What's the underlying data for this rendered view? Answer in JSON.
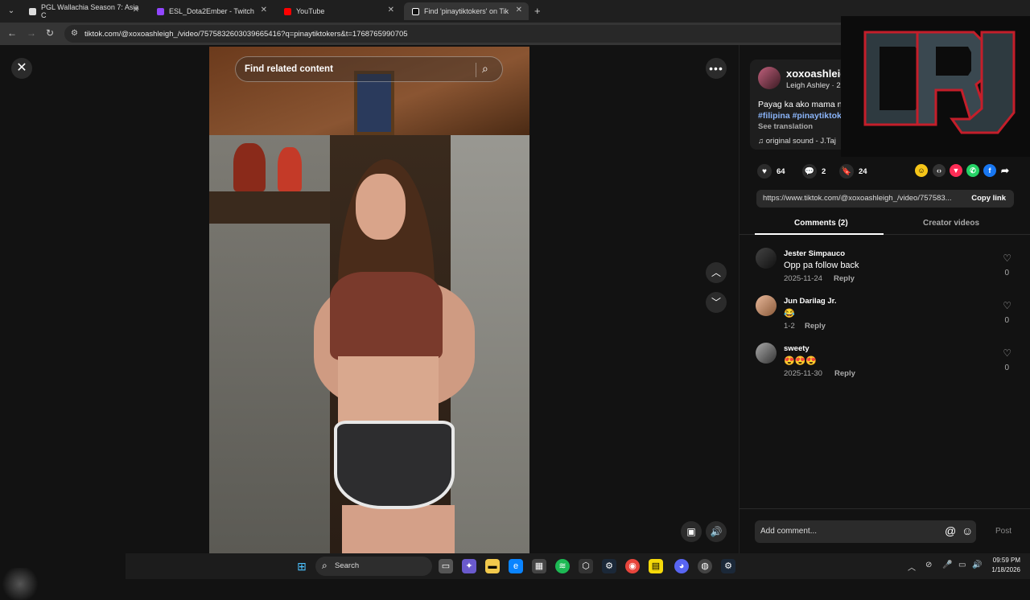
{
  "browser": {
    "tabs": [
      {
        "title": "PGL Wallachia Season 7: Asia C",
        "color": "#ffffff"
      },
      {
        "title": "ESL_Dota2Ember - Twitch",
        "color": "#9146ff"
      },
      {
        "title": "YouTube",
        "color": "#ff0000"
      },
      {
        "title": "Find 'pinaytiktokers' on Tik",
        "color": "#ffffff"
      }
    ],
    "url": "tiktok.com/@xoxoashleigh_/video/7575832603039665416?q=pinaytiktokers&t=1768765990705"
  },
  "video": {
    "search_placeholder": "Find related content"
  },
  "post": {
    "username": "xoxoashleig",
    "display": "Leigh Ashley · 2",
    "caption": "Payag ka ako mama n",
    "hashtags": "#filipina #pinaytiktok",
    "see_translation": "See translation",
    "sound": "original sound - J.Taj",
    "likes": "64",
    "comments": "2",
    "saves": "24",
    "link": "https://www.tiktok.com/@xoxoashleigh_/video/757583...",
    "copy_link": "Copy link"
  },
  "tabs": {
    "comments": "Comments (2)",
    "creator": "Creator videos"
  },
  "comments": [
    {
      "name": "Jester Simpauco",
      "text": "Opp pa follow back",
      "date": "2025-11-24",
      "reply": "Reply",
      "likes": "0"
    },
    {
      "name": "Jun Darilag Jr.",
      "text": "😂",
      "date": "1-2",
      "reply": "Reply",
      "likes": "0"
    },
    {
      "name": "sweety",
      "text": "😍😍😍",
      "date": "2025-11-30",
      "reply": "Reply",
      "likes": "0"
    }
  ],
  "add_comment": {
    "placeholder": "Add comment...",
    "post": "Post"
  },
  "taskbar": {
    "search": "Search",
    "time": "09:59 PM",
    "date": "1/18/2026"
  },
  "colors": {
    "accent_link": "#8ab4f8",
    "logo_red": "#c41e2a"
  }
}
